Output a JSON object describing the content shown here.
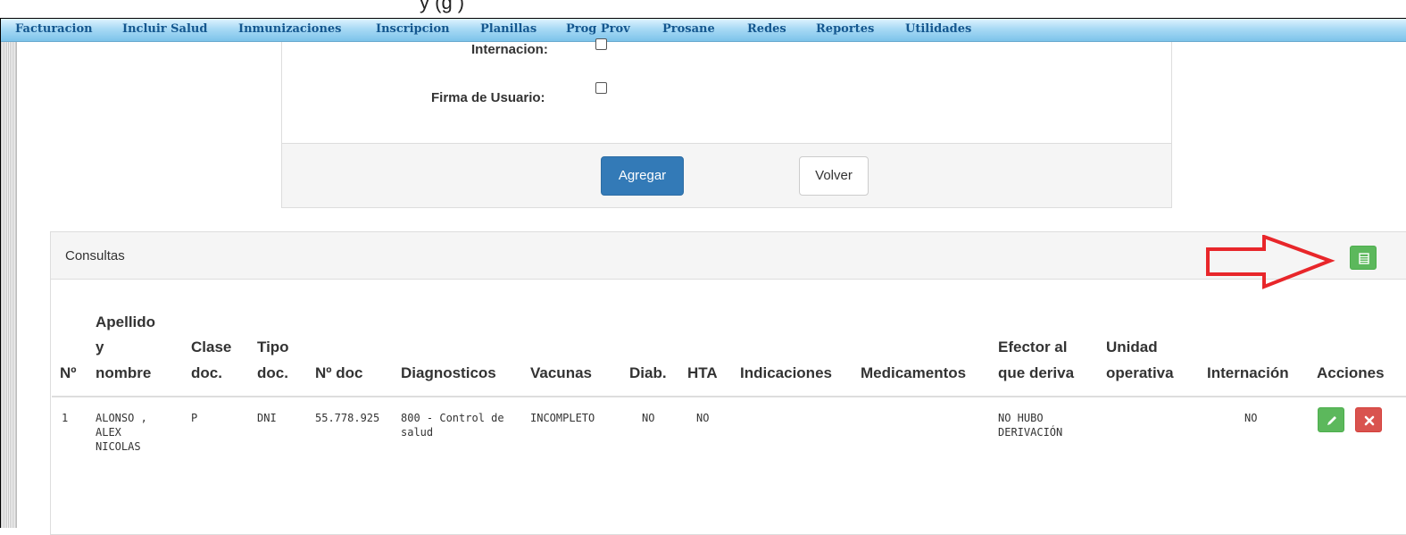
{
  "page_header": {
    "cut_text": "y          (g        )"
  },
  "menu": {
    "items": [
      "Facturacion",
      "Incluir Salud",
      "Inmunizaciones",
      "Inscripcion",
      "Planillas",
      "Prog Prov",
      "Prosane",
      "Redes",
      "Reportes",
      "Utilidades"
    ]
  },
  "form": {
    "internacion_label": "Internacion:",
    "firma_label": "Firma de Usuario:",
    "agregar_label": "Agregar",
    "volver_label": "Volver"
  },
  "consultas": {
    "title": "Consultas",
    "headers": {
      "n": "Nº",
      "apellido_1": "Apellido",
      "apellido_2": "y",
      "apellido_3": "nombre",
      "clase_1": "Clase",
      "clase_2": "doc.",
      "tipo_1": "Tipo",
      "tipo_2": "doc.",
      "ndoc": "Nº doc",
      "diagnosticos": "Diagnosticos",
      "vacunas": "Vacunas",
      "diab": "Diab.",
      "hta": "HTA",
      "indicaciones": "Indicaciones",
      "medicamentos": "Medicamentos",
      "efector_1": "Efector al",
      "efector_2": "que deriva",
      "unidad_1": "Unidad",
      "unidad_2": "operativa",
      "internacion": "Internación",
      "acciones": "Acciones"
    },
    "rows": [
      {
        "n": "1",
        "nombre_1": "ALONSO ,",
        "nombre_2": "ALEX",
        "nombre_3": "NICOLAS",
        "clase": "P",
        "tipo": "DNI",
        "ndoc": "55.778.925",
        "diag_1": "800 - Control de",
        "diag_2": "salud",
        "vacunas": "INCOMPLETO",
        "diab": "NO",
        "hta": "NO",
        "efector_1": "NO HUBO",
        "efector_2": "DERIVACIÓN",
        "internacion": "NO"
      }
    ]
  },
  "colors": {
    "menu_text": "#14578f",
    "primary": "#337ab7",
    "success": "#5cb85c",
    "danger": "#d9534f",
    "arrow": "#e8262a"
  },
  "icons": {
    "excel_export": "spreadsheet-icon",
    "edit": "pencil-icon",
    "delete": "close-icon",
    "annotation": "red-arrow-icon"
  }
}
